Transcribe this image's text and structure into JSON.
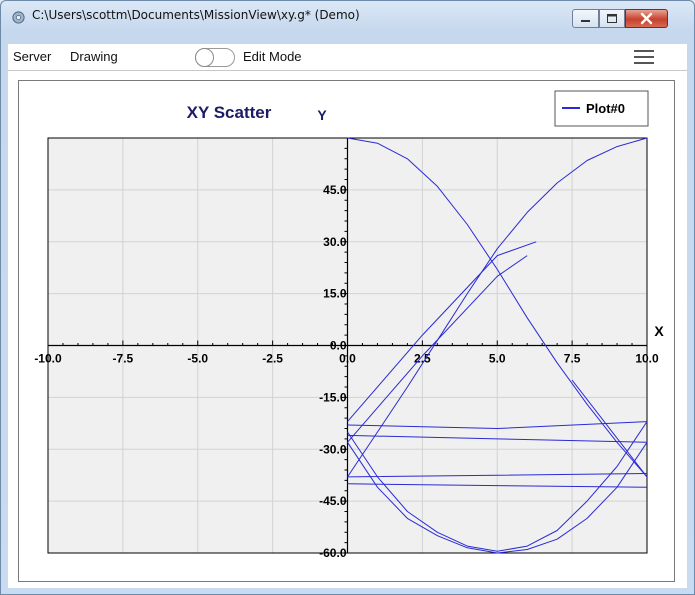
{
  "window": {
    "title": "C:\\Users\\scottm\\Documents\\MissionView\\xy.g* (Demo)"
  },
  "menu": {
    "server": "Server",
    "drawing": "Drawing",
    "edit_mode_label": "Edit Mode",
    "edit_mode_on": false
  },
  "icons": {
    "app": "gear-icon",
    "menu": "hamburger-icon",
    "minimize": "minimize-icon",
    "maximize": "maximize-icon",
    "close": "close-icon"
  },
  "colors": {
    "series": "#2a2ad6",
    "plot_bg": "#f0f0f0",
    "title": "#1c1c66"
  },
  "chart_data": {
    "type": "scatter",
    "title": "XY Scatter",
    "xlabel": "X",
    "ylabel": "Y",
    "xlim": [
      -10,
      10
    ],
    "ylim": [
      -60,
      60
    ],
    "x_ticks": [
      "-10.0",
      "-7.5",
      "-5.0",
      "-2.5",
      "0.0",
      "2.5",
      "5.0",
      "7.5",
      "10.0"
    ],
    "y_ticks": [
      "45.0",
      "30.0",
      "15.0",
      "0.0",
      "-15.0",
      "-30.0",
      "-45.0",
      "-60.0"
    ],
    "grid": true,
    "legend_position": "top-right",
    "series": [
      {
        "name": "Plot#0",
        "traces": [
          {
            "x": [
              0,
              1,
              2,
              3,
              4,
              5,
              6,
              7,
              8,
              9,
              10
            ],
            "y": [
              60,
              58.5,
              54,
              46,
              35,
              22,
              8,
              -5,
              -17,
              -28,
              -38
            ]
          },
          {
            "x": [
              0,
              1,
              2,
              3,
              4,
              5,
              6,
              7,
              8,
              9,
              10
            ],
            "y": [
              -38,
              -25,
              -12,
              1.5,
              15,
              28,
              38.5,
              47,
              53.5,
              57.5,
              60
            ]
          },
          {
            "x": [
              0,
              1,
              2,
              3,
              4,
              5,
              6,
              7,
              8,
              9,
              10
            ],
            "y": [
              -28,
              -41,
              -50,
              -55,
              -58.5,
              -60,
              -59,
              -56,
              -50,
              -41,
              -28
            ]
          },
          {
            "x": [
              0,
              1,
              2,
              3,
              4,
              5,
              6,
              7,
              8,
              9,
              10
            ],
            "y": [
              -25,
              -38,
              -48,
              -54,
              -58,
              -59.5,
              -58,
              -53.5,
              -45,
              -35,
              -22
            ]
          },
          {
            "x": [
              0,
              2.5,
              5,
              6.3
            ],
            "y": [
              -22,
              3,
              26,
              30
            ]
          },
          {
            "x": [
              0,
              2.5,
              5,
              6
            ],
            "y": [
              -28,
              -3,
              20,
              26
            ]
          },
          {
            "x": [
              7.5,
              10
            ],
            "y": [
              -10,
              -38
            ]
          },
          {
            "x": [
              0,
              5,
              10
            ],
            "y": [
              -23,
              -24,
              -22
            ]
          },
          {
            "x": [
              0,
              5,
              10
            ],
            "y": [
              -26,
              -27,
              -28
            ]
          },
          {
            "x": [
              0,
              5,
              10
            ],
            "y": [
              -38,
              -37.5,
              -37
            ]
          },
          {
            "x": [
              0,
              5,
              10
            ],
            "y": [
              -40,
              -40.5,
              -41
            ]
          }
        ]
      }
    ]
  }
}
